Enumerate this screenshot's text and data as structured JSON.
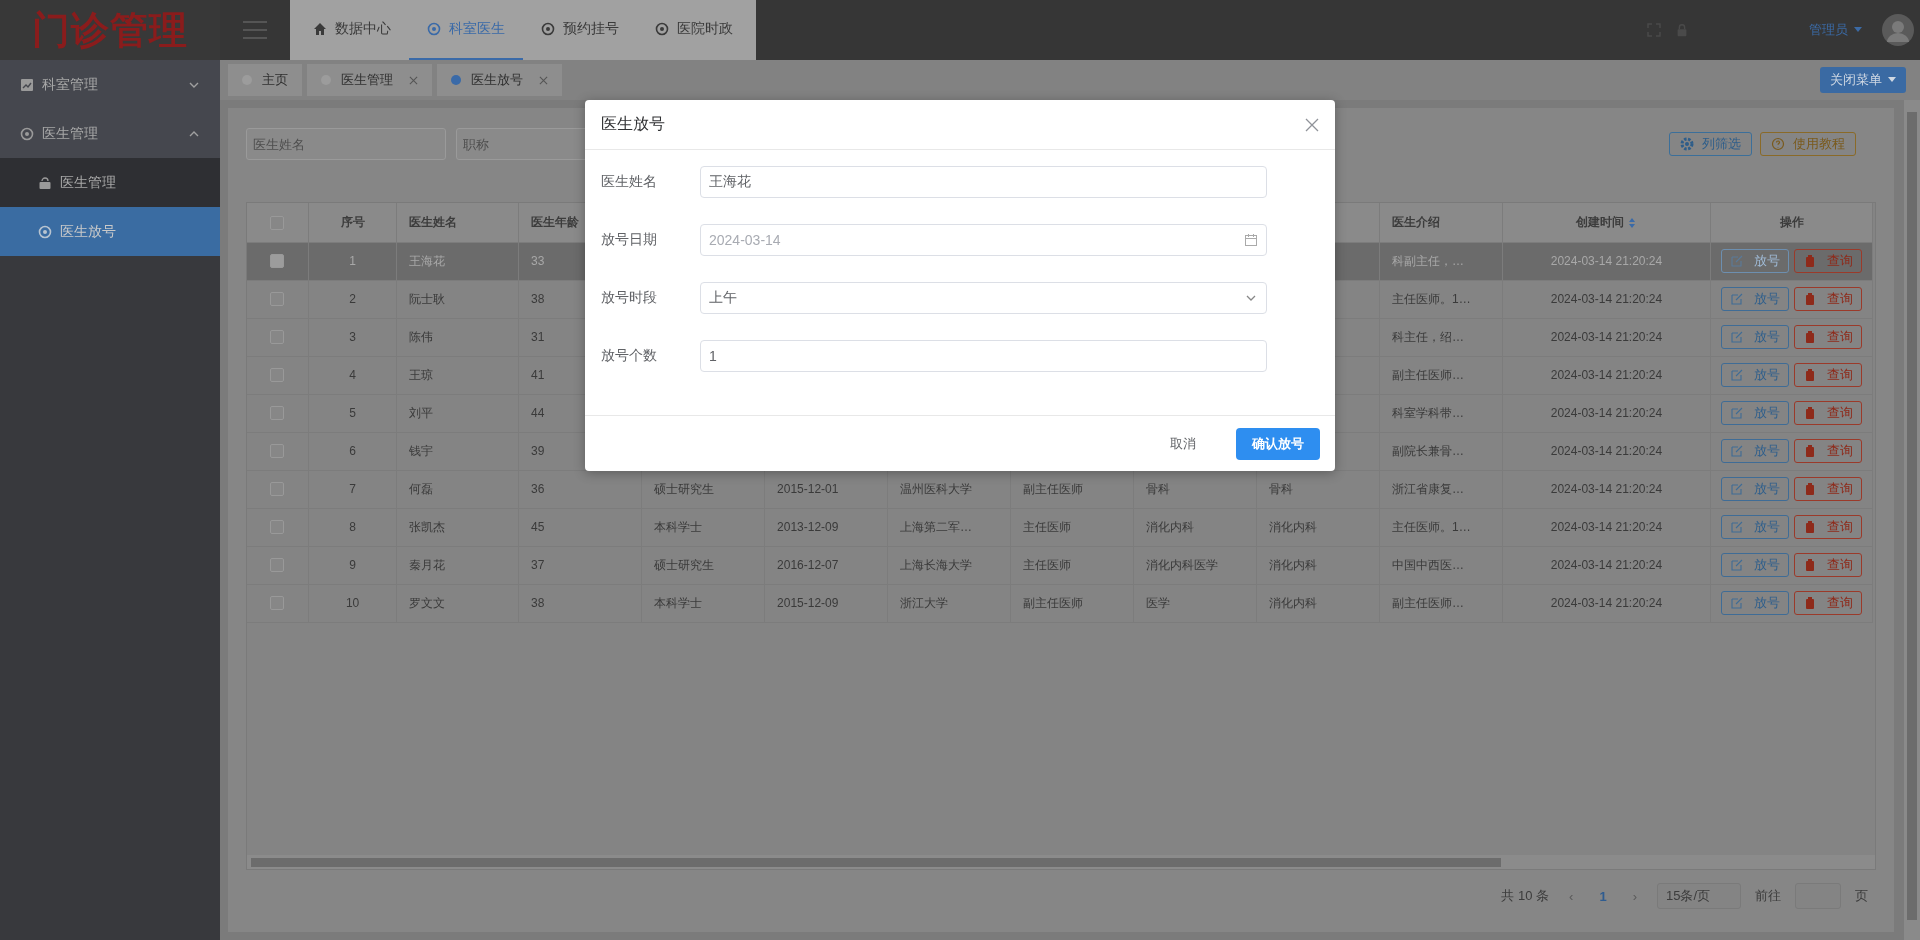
{
  "logo": "门诊管理",
  "top_nav": [
    {
      "label": "数据中心",
      "kind": "home",
      "selected": false
    },
    {
      "label": "科室医生",
      "kind": "module",
      "selected": true
    },
    {
      "label": "预约挂号",
      "kind": "module",
      "selected": false
    },
    {
      "label": "医院时政",
      "kind": "module",
      "selected": false
    }
  ],
  "user": {
    "name": "管理员"
  },
  "sidebar": {
    "items": [
      {
        "label": "科室管理",
        "kind": "chart",
        "expanded": false
      },
      {
        "label": "医生管理",
        "kind": "module",
        "expanded": true,
        "children": [
          {
            "label": "医生管理",
            "kind": "basket",
            "selected": false
          },
          {
            "label": "医生放号",
            "kind": "module",
            "selected": true
          }
        ]
      }
    ]
  },
  "page_tabs": [
    {
      "label": "主页",
      "closable": false,
      "selected": false
    },
    {
      "label": "医生管理",
      "closable": true,
      "selected": false
    },
    {
      "label": "医生放号",
      "closable": true,
      "selected": true
    }
  ],
  "close_menu_button": "关闭菜单",
  "filters": [
    {
      "placeholder": "医生姓名"
    },
    {
      "placeholder": "职称"
    }
  ],
  "toolbar": [
    {
      "label": "列筛选",
      "kind": "columns"
    },
    {
      "label": "使用教程",
      "kind": "help"
    }
  ],
  "table": {
    "all_checked": false,
    "columns_left": [
      {
        "label": "序号",
        "sortable": false
      },
      {
        "label": "医生姓名",
        "sortable": false
      },
      {
        "label": "医生年龄",
        "sortable": false
      }
    ],
    "columns_right": [
      {
        "label": "医生介绍",
        "sortable": false
      },
      {
        "label": "创建时间",
        "sortable": true
      },
      {
        "label": "操作",
        "sortable": false
      }
    ],
    "rows": [
      {
        "index": "1",
        "name": "王海花",
        "age": "33",
        "intro": "科副主任，…",
        "created": "2024-03-14 21:20:24",
        "actions": [
          "放号",
          "查询"
        ],
        "checked": false,
        "selected": true
      },
      {
        "index": "2",
        "name": "阮士耿",
        "age": "38",
        "intro": "主任医师。1…",
        "created": "2024-03-14 21:20:24",
        "actions": [
          "放号",
          "查询"
        ],
        "checked": false,
        "selected": false
      },
      {
        "index": "3",
        "name": "陈伟",
        "age": "31",
        "intro": "科主任，绍…",
        "created": "2024-03-14 21:20:24",
        "actions": [
          "放号",
          "查询"
        ],
        "checked": false,
        "selected": false
      },
      {
        "index": "4",
        "name": "王琼",
        "age": "41",
        "intro": "副主任医师…",
        "created": "2024-03-14 21:20:24",
        "actions": [
          "放号",
          "查询"
        ],
        "checked": false,
        "selected": false
      },
      {
        "index": "5",
        "name": "刘平",
        "age": "44",
        "intro": "科室学科带…",
        "created": "2024-03-14 21:20:24",
        "actions": [
          "放号",
          "查询"
        ],
        "checked": false,
        "selected": false
      },
      {
        "index": "6",
        "name": "钱宇",
        "age": "39",
        "intro": "副院长兼骨…",
        "created": "2024-03-14 21:20:24",
        "actions": [
          "放号",
          "查询"
        ],
        "checked": false,
        "selected": false
      },
      {
        "index": "7",
        "name": "何磊",
        "age": "36",
        "details": [
          "硕士研究生",
          "2015-12-01",
          "温州医科大学",
          "副主任医师",
          "骨科",
          "骨科"
        ],
        "intro": "浙江省康复…",
        "created": "2024-03-14 21:20:24",
        "actions": [
          "放号",
          "查询"
        ],
        "checked": false,
        "selected": false
      },
      {
        "index": "8",
        "name": "张凯杰",
        "age": "45",
        "details": [
          "本科学士",
          "2013-12-09",
          "上海第二军…",
          "主任医师",
          "消化内科",
          "消化内科"
        ],
        "intro": "主任医师。1…",
        "created": "2024-03-14 21:20:24",
        "actions": [
          "放号",
          "查询"
        ],
        "checked": false,
        "selected": false
      },
      {
        "index": "9",
        "name": "秦月花",
        "age": "37",
        "details": [
          "硕士研究生",
          "2016-12-07",
          "上海长海大学",
          "主任医师",
          "消化内科医学",
          "消化内科"
        ],
        "intro": "中国中西医…",
        "created": "2024-03-14 21:20:24",
        "actions": [
          "放号",
          "查询"
        ],
        "checked": false,
        "selected": false
      },
      {
        "index": "10",
        "name": "罗文文",
        "age": "38",
        "details": [
          "本科学士",
          "2015-12-09",
          "浙江大学",
          "副主任医师",
          "医学",
          "消化内科"
        ],
        "intro": "副主任医师…",
        "created": "2024-03-14 21:20:24",
        "actions": [
          "放号",
          "查询"
        ],
        "checked": false,
        "selected": false
      }
    ]
  },
  "pagination": {
    "total": "共 10 条",
    "prev": "‹",
    "page": "1",
    "next": "›",
    "page_size": "15条/页",
    "goto": "前往",
    "page_unit": "页"
  },
  "dialog": {
    "title": "医生放号",
    "fields": [
      {
        "label": "医生姓名",
        "kind": "text",
        "value": "王海花"
      },
      {
        "label": "放号日期",
        "kind": "date",
        "placeholder": "2024-03-14"
      },
      {
        "label": "放号时段",
        "kind": "select",
        "value": "上午"
      },
      {
        "label": "放号个数",
        "kind": "text",
        "value": "1"
      }
    ],
    "buttons": [
      {
        "label": "取消",
        "kind": "plain"
      },
      {
        "label": "确认放号",
        "kind": "primary"
      }
    ]
  }
}
